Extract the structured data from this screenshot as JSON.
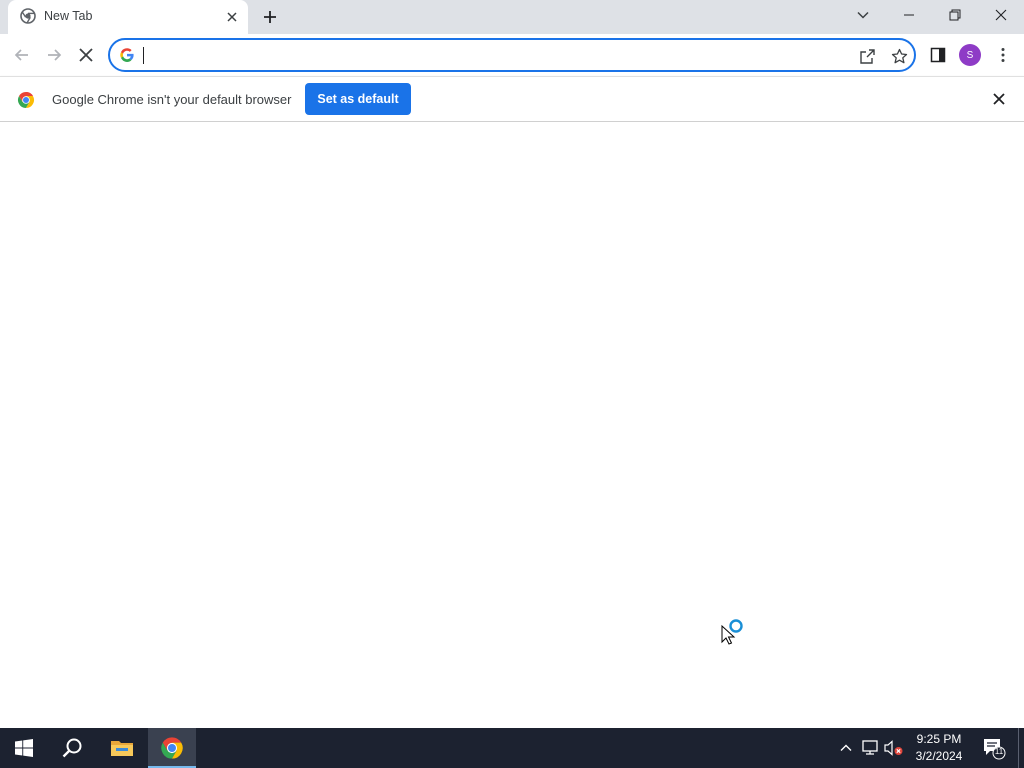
{
  "browser": {
    "tab": {
      "title": "New Tab"
    },
    "omnibox": {
      "value": "",
      "placeholder": ""
    }
  },
  "infobar": {
    "message": "Google Chrome isn't your default browser",
    "button_label": "Set as default"
  },
  "profile": {
    "initial": "S",
    "color": "#8e3bc6"
  },
  "taskbar": {
    "time": "9:25 PM",
    "date": "3/2/2024",
    "notification_count": "11",
    "apps": [
      "start-icon",
      "search-icon",
      "file-explorer-icon",
      "chrome-icon"
    ]
  },
  "colors": {
    "accent": "#1a73e8",
    "tab_strip": "#dee1e6",
    "taskbar": "#1c2230"
  }
}
